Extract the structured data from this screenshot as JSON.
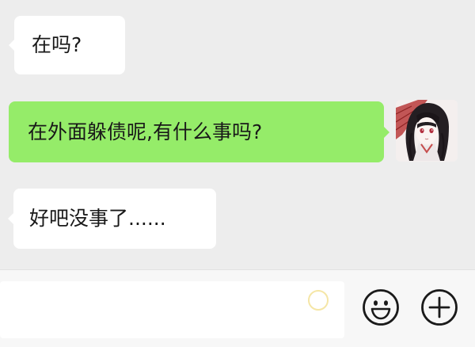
{
  "messages": [
    {
      "side": "left",
      "text": "在吗?"
    },
    {
      "side": "right",
      "text": "在外面躲债呢,有什么事吗?"
    },
    {
      "side": "left",
      "text": "好吧没事了......"
    }
  ],
  "input": {
    "value": "",
    "placeholder": ""
  },
  "icons": {
    "emoji": "emoji-smile-icon",
    "plus": "plus-circle-icon",
    "avatar": "anime-girl-avatar"
  },
  "colors": {
    "chat_background": "#ededed",
    "incoming_bubble": "#ffffff",
    "outgoing_bubble": "#95ec69",
    "input_bar": "#f7f7f7",
    "icon_stroke": "#1a1a1a"
  }
}
